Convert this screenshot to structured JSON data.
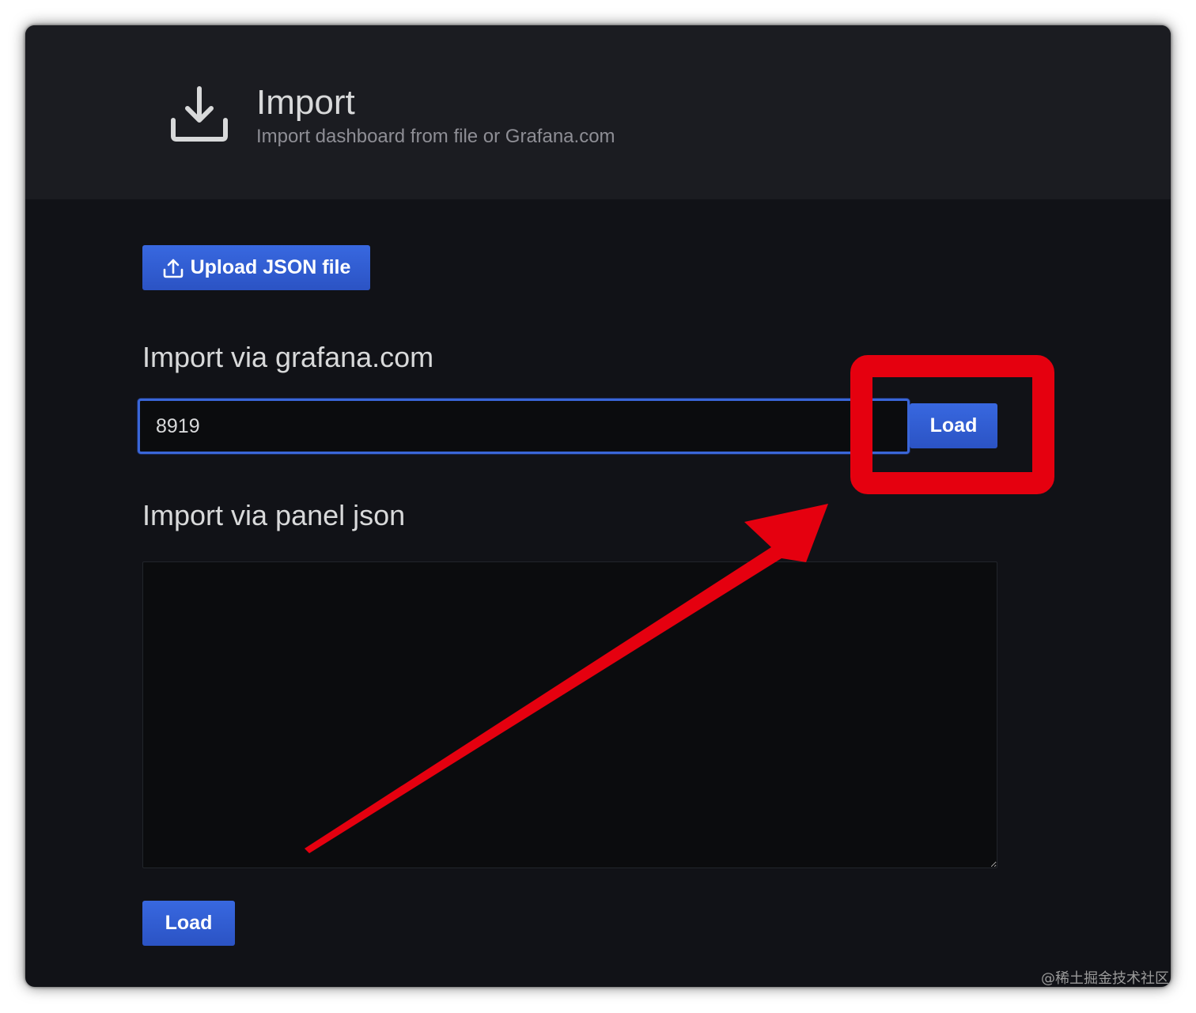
{
  "header": {
    "title": "Import",
    "subtitle": "Import dashboard from file or Grafana.com",
    "icon": "download-icon"
  },
  "upload": {
    "label": "Upload JSON file",
    "icon": "upload-icon"
  },
  "grafana_com": {
    "title": "Import via grafana.com",
    "input_value": "8919",
    "load_label": "Load"
  },
  "panel_json": {
    "title": "Import via panel json",
    "textarea_value": "",
    "load_label": "Load"
  },
  "annotation": {
    "color": "#e5000f"
  },
  "watermark": "@稀土掘金技术社区",
  "colors": {
    "background": "#111217",
    "header_background": "#1b1c21",
    "primary_button": "#2f5bd0",
    "input_focus_border": "#3a66d8"
  }
}
